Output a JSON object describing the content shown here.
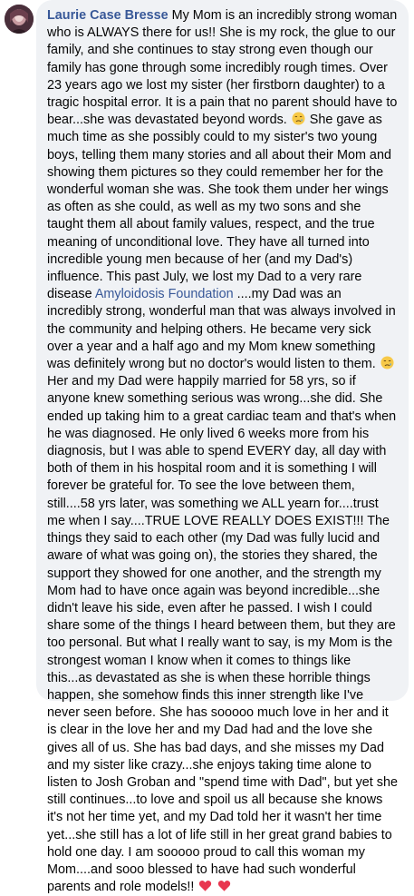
{
  "comment": {
    "author": "Laurie Case Bresse",
    "mention": "Amyloidosis Foundation",
    "text_part1": " My Mom is an incredibly strong woman who is ALWAYS there for us!! She is my rock, the glue to our family, and she continues to stay strong even though our family has gone through some incredibly rough times. Over 23 years ago we lost my sister (her firstborn daughter) to a tragic hospital error. It is a pain that no parent should have to bear...she was devastated beyond words. ",
    "text_part2": " She gave as much time as she possibly could to my sister's two young boys, telling them many stories and all about their Mom and showing them pictures so they could remember her for the wonderful woman she was. She took them under her wings as often as she could, as well as my two sons and she taught them all about family values, respect, and the true meaning of unconditional love. They have all turned into incredible young men because of her (and my Dad's) influence. This past July, we lost my Dad to a very rare disease ",
    "text_part3": " ....my Dad was an incredibly strong, wonderful man that was always involved in the community and helping others. He became very sick over a year and a half ago and my Mom knew something was definitely wrong but no doctor's would listen to them. ",
    "text_part4": " Her and my Dad were happily married for 58 yrs, so if anyone knew something serious was wrong...she did. She ended up taking him to a great cardiac team and that's when he was diagnosed. He only lived 6 weeks more from his diagnosis, but I was able to spend EVERY day, all day with both of them in his hospital room and it is something I will forever be grateful for. To see the love between them, still....58 yrs later, was something we ALL yearn for....trust me when I say....TRUE LOVE REALLY DOES EXIST!!! The things they said to each other (my Dad was fully lucid and aware of what was going on), the stories they shared, the support they showed for one another, and the strength my Mom had to have once again was beyond incredible...she didn't leave his side, even after he passed. I wish I could share some of the things I heard between them, but they are too personal. But what I really want to say, is my Mom is the strongest woman I know when it comes to things like this...as devastated as she is when these horrible things happen, she somehow finds this inner strength like I've never seen before. She has sooooo much love in her and it is clear in the love her and my Dad had and the love she gives all of us. She has bad days, and she misses my Dad and my sister like crazy...she enjoys taking time alone to listen to Josh Groban and \"spend time with Dad\", but yet she still continues...to love and spoil us all because she knows it's not her time yet, and my Dad told her it wasn't her time yet...she still has a lot of life still in her great grand babies to hold one day. I am sooooo proud to call this woman my Mom....and sooo blessed to have had such wonderful parents and role models!! ",
    "emojis": [
      "sad-tear-face",
      "sad-tear-face",
      "red-heart",
      "red-heart"
    ]
  },
  "colors": {
    "bubble_bg": "#f0f2f5",
    "text": "#050505",
    "link": "#385898",
    "heart": "#e8364f",
    "emoji_face": "#f7c948"
  }
}
